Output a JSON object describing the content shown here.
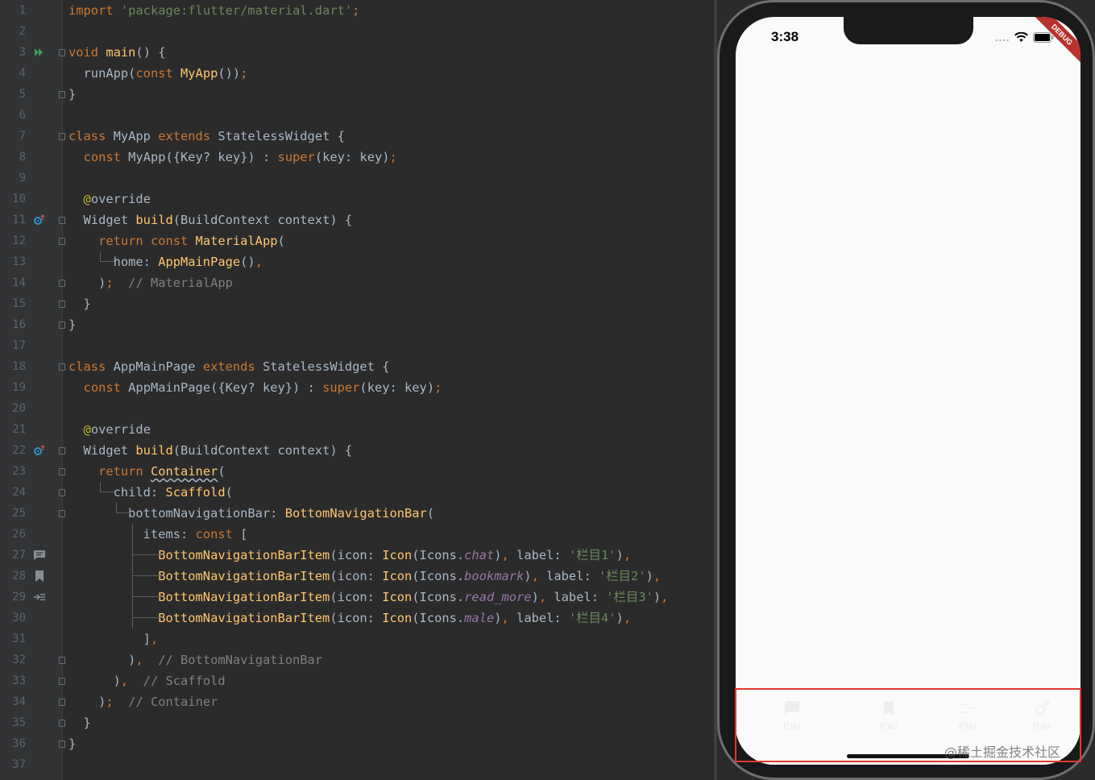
{
  "editor": {
    "line_numbers": [
      "1",
      "2",
      "3",
      "4",
      "5",
      "6",
      "7",
      "8",
      "9",
      "10",
      "11",
      "12",
      "13",
      "14",
      "15",
      "16",
      "17",
      "18",
      "19",
      "20",
      "21",
      "22",
      "23",
      "24",
      "25",
      "26",
      "27",
      "28",
      "29",
      "30",
      "31",
      "32",
      "33",
      "34",
      "35",
      "36",
      "37"
    ],
    "lines": {
      "l1": [
        [
          "kw",
          "import "
        ],
        [
          "str",
          "'package:flutter/material.dart'"
        ],
        [
          "kw",
          ";"
        ]
      ],
      "l3": [
        [
          "kw",
          "void "
        ],
        [
          "fn",
          "main"
        ],
        [
          "plain",
          "() {"
        ]
      ],
      "l4": [
        [
          "plain",
          "  runApp("
        ],
        [
          "kw",
          "const "
        ],
        [
          "fn",
          "MyApp"
        ],
        [
          "plain",
          "())"
        ],
        [
          "kw",
          ";"
        ]
      ],
      "l5": [
        [
          "plain",
          "}"
        ]
      ],
      "l7": [
        [
          "kw",
          "class "
        ],
        [
          "plain",
          "MyApp "
        ],
        [
          "kw",
          "extends "
        ],
        [
          "plain",
          "StatelessWidget {"
        ]
      ],
      "l8": [
        [
          "plain",
          "  "
        ],
        [
          "kw",
          "const "
        ],
        [
          "plain",
          "MyApp({Key? key}) : "
        ],
        [
          "kw",
          "super"
        ],
        [
          "plain",
          "(key: key)"
        ],
        [
          "kw",
          ";"
        ]
      ],
      "l10": [
        [
          "plain",
          "  "
        ],
        [
          "ann",
          "@"
        ],
        [
          "plain",
          "override"
        ]
      ],
      "l11": [
        [
          "plain",
          "  Widget "
        ],
        [
          "fn",
          "build"
        ],
        [
          "plain",
          "(BuildContext context) {"
        ]
      ],
      "l12": [
        [
          "plain",
          "    "
        ],
        [
          "kw",
          "return const "
        ],
        [
          "fn",
          "MaterialApp"
        ],
        [
          "plain",
          "("
        ]
      ],
      "l13": [
        [
          "plain",
          "      home: "
        ],
        [
          "fn",
          "AppMainPage"
        ],
        [
          "plain",
          "()"
        ],
        [
          "kw",
          ","
        ]
      ],
      "l14": [
        [
          "plain",
          "    )"
        ],
        [
          "kw",
          ";"
        ],
        [
          "plain",
          "  "
        ],
        [
          "cmt",
          "// MaterialApp"
        ]
      ],
      "l15": [
        [
          "plain",
          "  }"
        ]
      ],
      "l16": [
        [
          "plain",
          "}"
        ]
      ],
      "l18": [
        [
          "kw",
          "class "
        ],
        [
          "plain",
          "AppMainPage "
        ],
        [
          "kw",
          "extends "
        ],
        [
          "plain",
          "StatelessWidget {"
        ]
      ],
      "l19": [
        [
          "plain",
          "  "
        ],
        [
          "kw",
          "const "
        ],
        [
          "plain",
          "AppMainPage({Key? key}) : "
        ],
        [
          "kw",
          "super"
        ],
        [
          "plain",
          "(key: key)"
        ],
        [
          "kw",
          ";"
        ]
      ],
      "l21": [
        [
          "plain",
          "  "
        ],
        [
          "ann",
          "@"
        ],
        [
          "plain",
          "override"
        ]
      ],
      "l22": [
        [
          "plain",
          "  Widget "
        ],
        [
          "fn",
          "build"
        ],
        [
          "plain",
          "(BuildContext context) {"
        ]
      ],
      "l23": [
        [
          "plain",
          "    "
        ],
        [
          "kw",
          "return "
        ],
        [
          "fnul",
          "Container"
        ],
        [
          "plain",
          "("
        ]
      ],
      "l24": [
        [
          "plain",
          "      child: "
        ],
        [
          "fn",
          "Scaffold"
        ],
        [
          "plain",
          "("
        ]
      ],
      "l25": [
        [
          "plain",
          "        bottomNavigationBar: "
        ],
        [
          "fn",
          "BottomNavigationBar"
        ],
        [
          "plain",
          "("
        ]
      ],
      "l26": [
        [
          "plain",
          "          items: "
        ],
        [
          "kw",
          "const "
        ],
        [
          "plain",
          "["
        ]
      ],
      "l27": [
        [
          "plain",
          "            "
        ],
        [
          "fn",
          "BottomNavigationBarItem"
        ],
        [
          "plain",
          "(icon: "
        ],
        [
          "fn",
          "Icon"
        ],
        [
          "plain",
          "(Icons."
        ],
        [
          "it",
          "chat"
        ],
        [
          "plain",
          ")"
        ],
        [
          "kw",
          ", "
        ],
        [
          "plain",
          "label: "
        ],
        [
          "str",
          "'栏目1'"
        ],
        [
          "plain",
          ")"
        ],
        [
          "kw",
          ","
        ]
      ],
      "l28": [
        [
          "plain",
          "            "
        ],
        [
          "fn",
          "BottomNavigationBarItem"
        ],
        [
          "plain",
          "(icon: "
        ],
        [
          "fn",
          "Icon"
        ],
        [
          "plain",
          "(Icons."
        ],
        [
          "it",
          "bookmark"
        ],
        [
          "plain",
          ")"
        ],
        [
          "kw",
          ", "
        ],
        [
          "plain",
          "label: "
        ],
        [
          "str",
          "'栏目2'"
        ],
        [
          "plain",
          ")"
        ],
        [
          "kw",
          ","
        ]
      ],
      "l29": [
        [
          "plain",
          "            "
        ],
        [
          "fn",
          "BottomNavigationBarItem"
        ],
        [
          "plain",
          "(icon: "
        ],
        [
          "fn",
          "Icon"
        ],
        [
          "plain",
          "(Icons."
        ],
        [
          "it",
          "read_more"
        ],
        [
          "plain",
          ")"
        ],
        [
          "kw",
          ", "
        ],
        [
          "plain",
          "label: "
        ],
        [
          "str",
          "'栏目3'"
        ],
        [
          "plain",
          ")"
        ],
        [
          "kw",
          ","
        ]
      ],
      "l30": [
        [
          "plain",
          "            "
        ],
        [
          "fn",
          "BottomNavigationBarItem"
        ],
        [
          "plain",
          "(icon: "
        ],
        [
          "fn",
          "Icon"
        ],
        [
          "plain",
          "(Icons."
        ],
        [
          "it",
          "male"
        ],
        [
          "plain",
          ")"
        ],
        [
          "kw",
          ", "
        ],
        [
          "plain",
          "label: "
        ],
        [
          "str",
          "'栏目4'"
        ],
        [
          "plain",
          ")"
        ],
        [
          "kw",
          ","
        ]
      ],
      "l31": [
        [
          "plain",
          "          ]"
        ],
        [
          "kw",
          ","
        ]
      ],
      "l32": [
        [
          "plain",
          "        )"
        ],
        [
          "kw",
          ","
        ],
        [
          "plain",
          "  "
        ],
        [
          "cmt",
          "// BottomNavigationBar"
        ]
      ],
      "l33": [
        [
          "plain",
          "      )"
        ],
        [
          "kw",
          ","
        ],
        [
          "plain",
          "  "
        ],
        [
          "cmt",
          "// Scaffold"
        ]
      ],
      "l34": [
        [
          "plain",
          "    )"
        ],
        [
          "kw",
          ";"
        ],
        [
          "plain",
          "  "
        ],
        [
          "cmt",
          "// Container"
        ]
      ],
      "l35": [
        [
          "plain",
          "  }"
        ]
      ],
      "l36": [
        [
          "plain",
          "}"
        ]
      ]
    }
  },
  "simulator": {
    "time": "3:38",
    "debug_banner": "DEBUG",
    "nav_items": [
      {
        "icon": "chat-icon",
        "label": "栏目1"
      },
      {
        "icon": "bookmark-icon",
        "label": "栏目2"
      },
      {
        "icon": "read-more-icon",
        "label": "栏目3"
      },
      {
        "icon": "male-icon",
        "label": "栏目4"
      }
    ]
  },
  "watermark": "@稀土掘金技术社区",
  "colors": {
    "editor_bg": "#2b2b2b",
    "keyword": "#cc7832",
    "function": "#ffc66d",
    "string": "#6a8759",
    "comment": "#808080",
    "highlight_box": "#e03c2c"
  }
}
